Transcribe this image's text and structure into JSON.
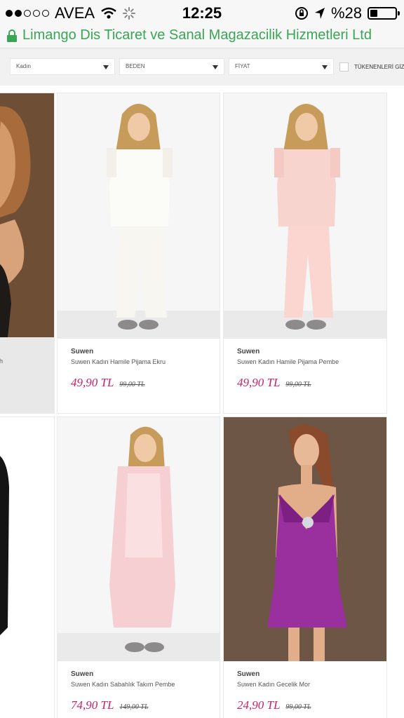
{
  "status_bar": {
    "carrier": "AVEA",
    "time": "12:25",
    "battery_text": "%28",
    "battery_level": 0.28,
    "signal_bars_filled": 2,
    "signal_bars_total": 5
  },
  "url_bar": {
    "site_title": "Limango Dis Ticaret ve Sanal Magazacilik Hizmetleri Ltd"
  },
  "filters": {
    "gender": "Kadın",
    "size": "BEDEN",
    "price": "FİYAT",
    "sold_out_label": "TÜKENENLERİ GİZL"
  },
  "products": [
    {
      "brand": "",
      "name": "h",
      "price": "",
      "old_price": ""
    },
    {
      "brand": "Suwen",
      "name": "Suwen Kadın Hamile Pijama Ekru",
      "price": "49,90 TL",
      "old_price": "99,00 TL"
    },
    {
      "brand": "Suwen",
      "name": "Suwen Kadın Hamile Pijama Pembe",
      "price": "49,90 TL",
      "old_price": "99,00 TL"
    },
    {
      "brand": "",
      "name": "",
      "price": "",
      "old_price": ""
    },
    {
      "brand": "Suwen",
      "name": "Suwen Kadın Sabahlık Takım Pembe",
      "price": "74,90 TL",
      "old_price": "149,00 TL"
    },
    {
      "brand": "Suwen",
      "name": "Suwen Kadın Gecelik Mor",
      "price": "24,90 TL",
      "old_price": "99,00 TL"
    }
  ],
  "colors": {
    "price": "#c8226a",
    "secure_green": "#3aa655"
  }
}
